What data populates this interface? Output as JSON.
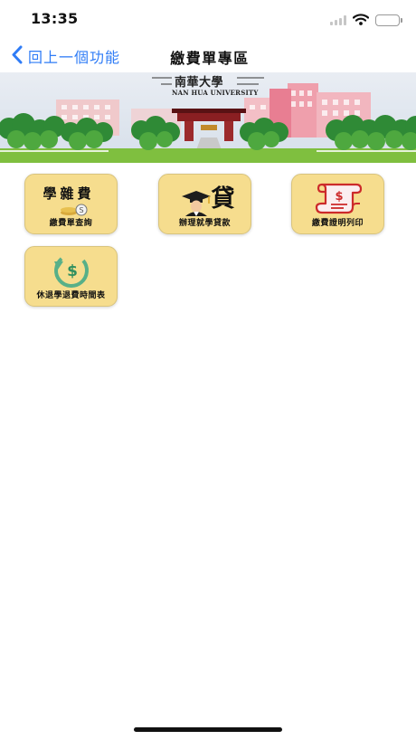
{
  "status_bar": {
    "time": "13:35",
    "icons": [
      "cellular-signal-icon",
      "wifi-icon",
      "battery-icon"
    ]
  },
  "nav": {
    "back_label": "回上一個功能",
    "title": "繳費單專區",
    "back_icon": "chevron-left-icon"
  },
  "banner": {
    "title": "南華大學",
    "subtitle": "NAN HUA UNIVERSITY"
  },
  "tiles": [
    {
      "label": "繳費單查詢",
      "icon": "tuition-fee-icon",
      "icon_text": "學雜費"
    },
    {
      "label": "辦理就學貸款",
      "icon": "graduate-loan-icon",
      "icon_text": "貸"
    },
    {
      "label": "繳費證明列印",
      "icon": "receipt-scroll-icon"
    },
    {
      "label": "休退學退費時間表",
      "icon": "refund-dollar-icon"
    }
  ],
  "colors": {
    "accent": "#2f7cf6",
    "tile_bg": "#f6dd8e",
    "tile_border": "#d9c47d",
    "receipt_red": "#cc2a2a",
    "refund_green": "#58b088"
  }
}
